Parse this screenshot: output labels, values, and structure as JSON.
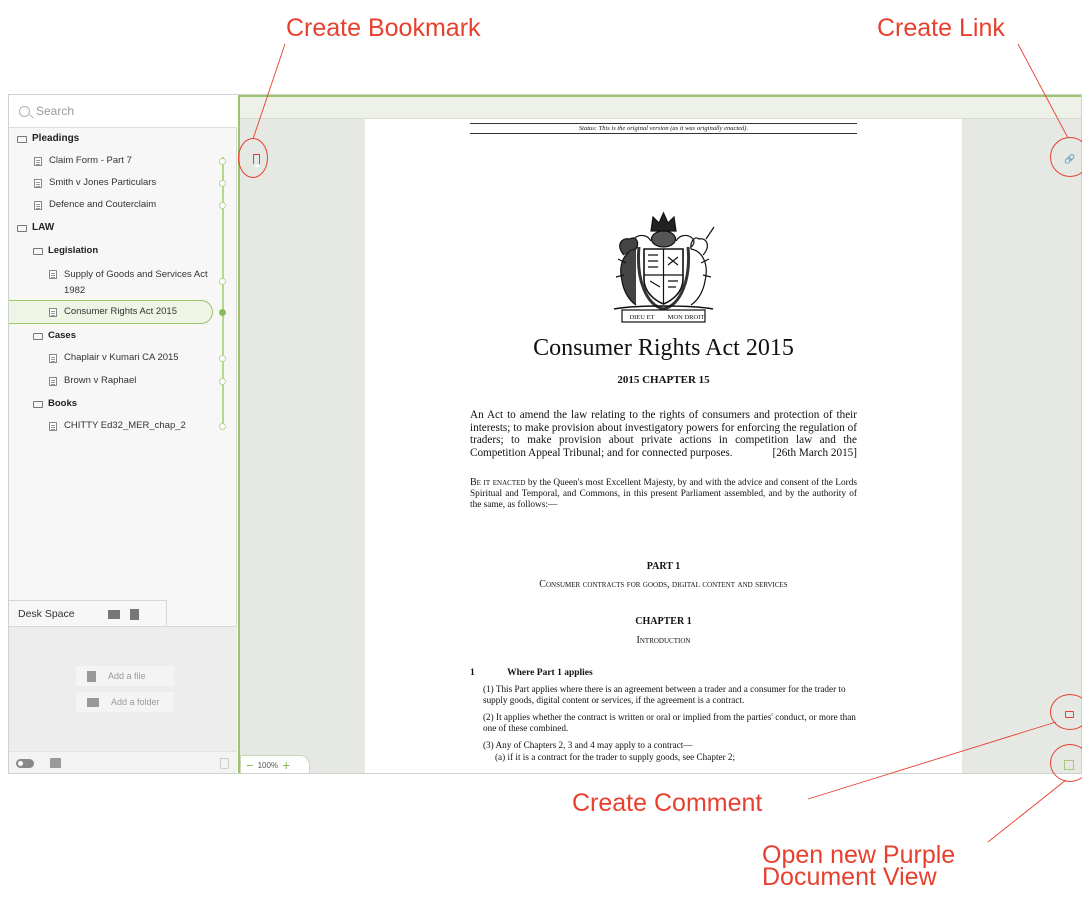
{
  "annotations": {
    "create_bookmark": "Create Bookmark",
    "create_link": "Create Link",
    "create_comment": "Create Comment",
    "open_purple": "Open new Purple\nDocument View",
    "color": "#e8402f"
  },
  "sidebar": {
    "search_placeholder": "Search",
    "tree": [
      {
        "type": "folder",
        "label": "Pleadings"
      },
      {
        "type": "doc",
        "label": "Claim Form - Part 7"
      },
      {
        "type": "doc",
        "label": "Smith v Jones Particulars"
      },
      {
        "type": "doc",
        "label": "Defence and Couterclaim"
      },
      {
        "type": "folder",
        "label": "LAW"
      },
      {
        "type": "folder",
        "label": "Legislation"
      },
      {
        "type": "doc",
        "label": "Supply of Goods and Services Act 1982"
      },
      {
        "type": "doc",
        "label": "Consumer Rights Act 2015",
        "selected": true
      },
      {
        "type": "folder",
        "label": "Cases"
      },
      {
        "type": "doc",
        "label": "Chaplair v Kumari CA 2015"
      },
      {
        "type": "doc",
        "label": "Brown v Raphael"
      },
      {
        "type": "folder",
        "label": "Books"
      },
      {
        "type": "doc",
        "label": "CHITTY Ed32_MER_chap_2"
      }
    ],
    "desk_space": {
      "title": "Desk Space",
      "add_file": "Add a file",
      "add_folder": "Add a folder"
    }
  },
  "viewer": {
    "zoom": "100%",
    "accent": "#9dc46a"
  },
  "document": {
    "status": "Status: This is the original version (as it was originally enacted).",
    "title": "Consumer Rights Act 2015",
    "chapter": "2015 CHAPTER 15",
    "long_title": "An Act to amend the law relating to the rights of consumers and protection of their interests; to make provision about investigatory powers for enforcing the regulation of traders; to make provision about private actions in competition law and the Competition Appeal Tribunal; and for connected purposes.",
    "date": "[26th March 2015]",
    "enacting_lead": "Be it enacted",
    "enacting": " by the Queen's most Excellent Majesty, by and with the advice and consent of the Lords Spiritual and Temporal, and Commons, in this present Parliament assembled, and by the authority of the same, as follows:—",
    "part": "PART 1",
    "part_title": "Consumer contracts for goods, digital content and services",
    "chapter1": "CHAPTER 1",
    "chapter1_title": "Introduction",
    "s1_num": "1",
    "s1_title": "Where Part 1 applies",
    "s1_1": "(1) This Part applies where there is an agreement between a trader and a consumer for the trader to supply goods, digital content or services, if the agreement is a contract.",
    "s1_2": "(2) It applies whether the contract is written or oral or implied from the parties' conduct, or more than one of these combined.",
    "s1_3": "(3) Any of Chapters 2, 3 and 4 may apply to a contract—",
    "s1_3a": "(a)    if it is a contract for the trader to supply goods, see Chapter 2;",
    "crest_motto_left": "DIEU ET",
    "crest_motto_right": "MON DROIT"
  }
}
